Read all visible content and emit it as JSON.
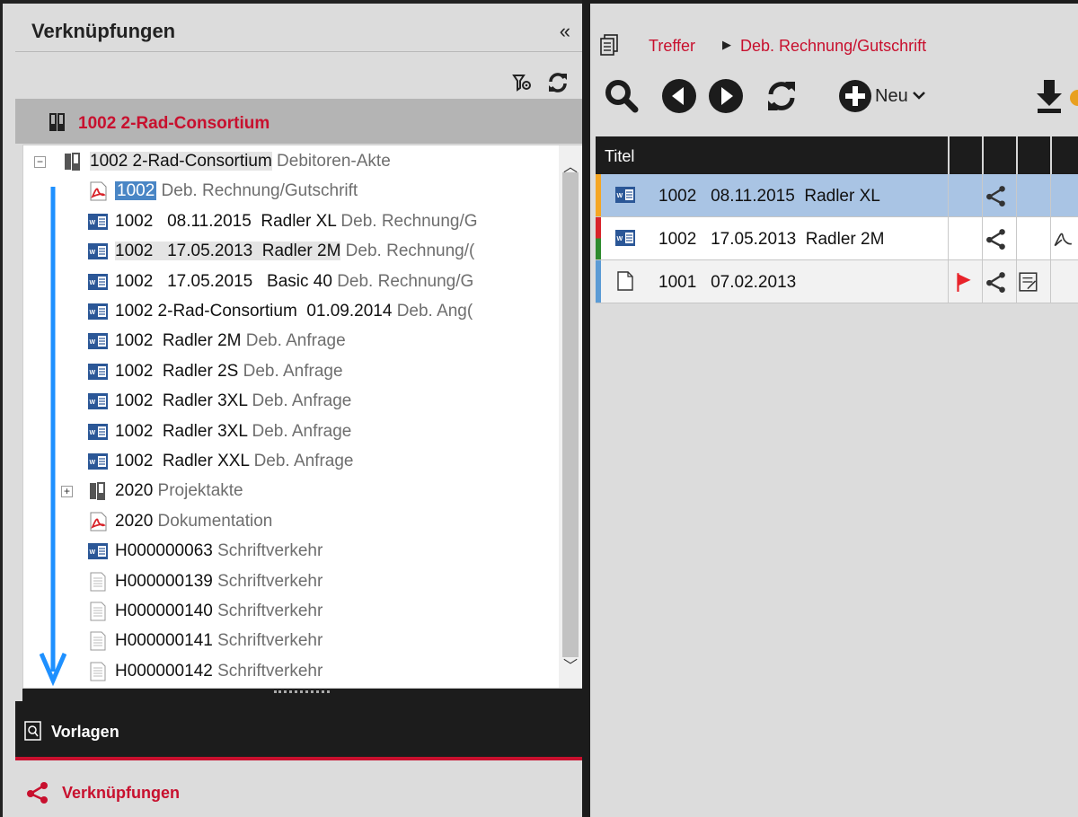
{
  "left_panel": {
    "title": "Verknüpfungen",
    "collapse_glyph": "«",
    "breadcrumb": "1002  2-Rad-Consortium",
    "tree": [
      {
        "num": "1002 2-Rad-Consortium",
        "type": "Debitoren-Akte",
        "icon": "folder-icon",
        "indent": 0,
        "expander": "⊟"
      },
      {
        "num": "1002",
        "type": "Deb. Rechnung/Gutschrift",
        "icon": "pdf-icon",
        "indent": 1
      },
      {
        "num": "1002   08.11.2015  Radler XL",
        "type": "Deb. Rechnung/G",
        "icon": "word-icon",
        "indent": 1
      },
      {
        "num": "1002   17.05.2013  Radler 2M",
        "type": "Deb. Rechnung/(",
        "icon": "word-icon",
        "indent": 1
      },
      {
        "num": "1002   17.05.2015   Basic 40",
        "type": "Deb. Rechnung/G",
        "icon": "word-icon",
        "indent": 1
      },
      {
        "num": "1002 2-Rad-Consortium  01.09.2014",
        "type": "Deb. Ang(",
        "icon": "word-icon",
        "indent": 1
      },
      {
        "num": "1002  Radler 2M",
        "type": "Deb. Anfrage",
        "icon": "word-icon",
        "indent": 1
      },
      {
        "num": "1002  Radler 2S",
        "type": "Deb. Anfrage",
        "icon": "word-icon",
        "indent": 1
      },
      {
        "num": "1002  Radler 3XL",
        "type": "Deb. Anfrage",
        "icon": "word-icon",
        "indent": 1
      },
      {
        "num": "1002  Radler 3XL",
        "type": "Deb. Anfrage",
        "icon": "word-icon",
        "indent": 1
      },
      {
        "num": "1002  Radler XXL",
        "type": "Deb. Anfrage",
        "icon": "word-icon",
        "indent": 1
      },
      {
        "num": "2020",
        "type": "Projektakte",
        "icon": "folder-icon",
        "indent": 1,
        "expander": "⊞"
      },
      {
        "num": "2020",
        "type": "Dokumentation",
        "icon": "pdf-icon",
        "indent": 1
      },
      {
        "num": "H000000063",
        "type": "Schriftverkehr",
        "icon": "word-icon",
        "indent": 1
      },
      {
        "num": "H000000139",
        "type": "Schriftverkehr",
        "icon": "text-file-icon",
        "indent": 1
      },
      {
        "num": "H000000140",
        "type": "Schriftverkehr",
        "icon": "text-file-icon",
        "indent": 1
      },
      {
        "num": "H000000141",
        "type": "Schriftverkehr",
        "icon": "text-file-icon",
        "indent": 1
      },
      {
        "num": "H000000142",
        "type": "Schriftverkehr",
        "icon": "text-file-icon",
        "indent": 1
      }
    ],
    "bottom_tabs": {
      "vorlagen": "Vorlagen",
      "verknuepfungen": "Verknüpfungen"
    }
  },
  "right_panel": {
    "breadcrumb": [
      "Treffer",
      "Deb. Rechnung/Gutschrift"
    ],
    "toolbar": {
      "new_label": "Neu"
    },
    "grid": {
      "header_title": "Titel",
      "rows": [
        {
          "text": "1002   08.11.2015  Radler XL",
          "stripe": "#f5a623",
          "icon": "word-icon",
          "selected": true,
          "extra": [
            "share-icon"
          ]
        },
        {
          "text": "1002   17.05.2013  Radler 2M",
          "stripe": "red-green",
          "icon": "word-icon",
          "selected": false,
          "extra": [
            "share-icon",
            "pdf-outline-icon"
          ]
        },
        {
          "text": "1001   07.02.2013",
          "stripe": "#5b9bd5",
          "icon": "blank-file-icon",
          "selected": false,
          "extra": [
            "flag-icon",
            "share-icon",
            "note-icon"
          ]
        }
      ]
    }
  },
  "colors": {
    "accent_red": "#c8102e",
    "selection_blue": "#4a86c5",
    "row_selected": "#a9c4e4",
    "arrow_blue": "#1e90ff"
  }
}
